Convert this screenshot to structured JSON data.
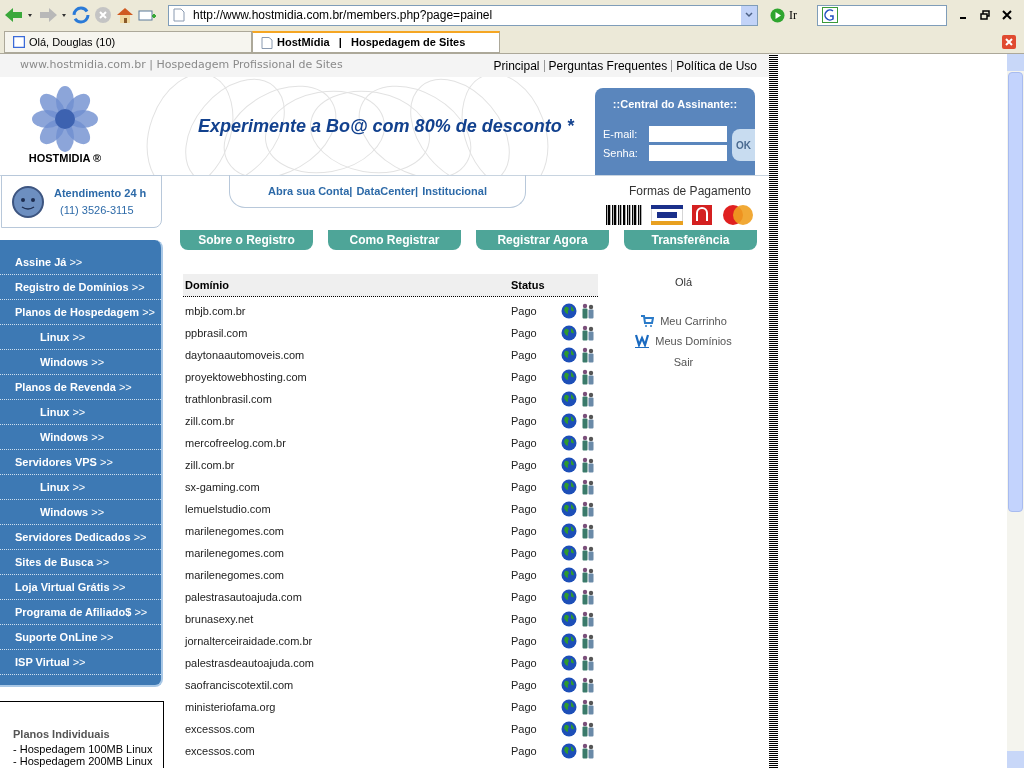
{
  "browser": {
    "url": "http://www.hostmidia.com.br/members.php?page=painel",
    "go_label": "Ir",
    "tabs": [
      {
        "label": "Olá, Douglas (10)",
        "selected": false
      },
      {
        "label": "HostMídia   |   Hospedagem de Sites",
        "selected": true
      }
    ]
  },
  "topbar": {
    "site": "www.hostmidia.com.br | Hospedagem Profissional de Sites",
    "links": [
      "Principal",
      "Perguntas Frequentes",
      "Política de Uso"
    ]
  },
  "banner": {
    "logo": "HOSTMIDIA ®",
    "headline": "Experimente a Bo@ com 80% de desconto *"
  },
  "login": {
    "title": "::Central do Assinante::",
    "email_label": "E-mail:",
    "password_label": "Senha:",
    "button": "OK"
  },
  "support": {
    "title": "Atendimento 24 h",
    "phone": "(11) 3526-3115"
  },
  "nav_links": [
    "Abra sua Conta|",
    "DataCenter|",
    "Institucional"
  ],
  "payment": {
    "title": "Formas de Pagamento"
  },
  "action_buttons": [
    "Sobre o Registro",
    "Como Registrar",
    "Registrar Agora",
    "Transferência"
  ],
  "sidebar": {
    "items": [
      {
        "label": "Assine Já",
        "arrow": ">>"
      },
      {
        "label": "Registro de Domínios",
        "arrow": ">>"
      },
      {
        "label": "Planos de Hospedagem",
        "arrow": ">>",
        "children": [
          {
            "label": "Linux",
            "arrow": ">>"
          },
          {
            "label": "Windows",
            "arrow": ">>"
          }
        ]
      },
      {
        "label": "Planos de Revenda",
        "arrow": ">>",
        "children": [
          {
            "label": "Linux",
            "arrow": ">>"
          },
          {
            "label": "Windows",
            "arrow": ">>"
          }
        ]
      },
      {
        "label": "Servidores VPS",
        "arrow": ">>",
        "children": [
          {
            "label": "Linux",
            "arrow": ">>"
          },
          {
            "label": "Windows",
            "arrow": ">>"
          }
        ]
      },
      {
        "label": "Servidores Dedicados",
        "arrow": ">>"
      },
      {
        "label": "Sites de Busca",
        "arrow": ">>"
      },
      {
        "label": "Loja Virtual Grátis",
        "arrow": ">>"
      },
      {
        "label": "Programa de Afiliado$",
        "arrow": ">>"
      },
      {
        "label": "Suporte OnLine",
        "arrow": ">>"
      },
      {
        "label": "ISP Virtual",
        "arrow": ">>"
      }
    ]
  },
  "plans": {
    "title": "Planos Individuais",
    "items": [
      "- Hospedagem 100MB Linux",
      "- Hospedagem 200MB Linux"
    ]
  },
  "table": {
    "columns": [
      "Domínio",
      "Status"
    ],
    "rows": [
      {
        "domain": "mbjb.com.br",
        "status": "Pago"
      },
      {
        "domain": "ppbrasil.com",
        "status": "Pago"
      },
      {
        "domain": "daytonaautomoveis.com",
        "status": "Pago"
      },
      {
        "domain": "proyektowebhosting.com",
        "status": "Pago"
      },
      {
        "domain": "trathlonbrasil.com",
        "status": "Pago"
      },
      {
        "domain": "zill.com.br",
        "status": "Pago"
      },
      {
        "domain": "mercofreelog.com.br",
        "status": "Pago"
      },
      {
        "domain": "zill.com.br",
        "status": "Pago"
      },
      {
        "domain": "sx-gaming.com",
        "status": "Pago"
      },
      {
        "domain": "lemuelstudio.com",
        "status": "Pago"
      },
      {
        "domain": "marilenegomes.com",
        "status": "Pago"
      },
      {
        "domain": "marilenegomes.com",
        "status": "Pago"
      },
      {
        "domain": "marilenegomes.com",
        "status": "Pago"
      },
      {
        "domain": "palestrasautoajuda.com",
        "status": "Pago"
      },
      {
        "domain": "brunasexy.net",
        "status": "Pago"
      },
      {
        "domain": "jornalterceiraidade.com.br",
        "status": "Pago"
      },
      {
        "domain": "palestrasdeautoajuda.com",
        "status": "Pago"
      },
      {
        "domain": "saofranciscotextil.com",
        "status": "Pago"
      },
      {
        "domain": "ministeriofama.org",
        "status": "Pago"
      },
      {
        "domain": "excessos.com",
        "status": "Pago"
      },
      {
        "domain": "excessos.com",
        "status": "Pago"
      }
    ]
  },
  "user_panel": {
    "greeting": "Olá",
    "links": [
      {
        "label": "Meu Carrinho",
        "kind": "cart"
      },
      {
        "label": "Meus Domínios",
        "kind": "domains"
      },
      {
        "label": "Sair",
        "kind": "plain"
      }
    ]
  }
}
